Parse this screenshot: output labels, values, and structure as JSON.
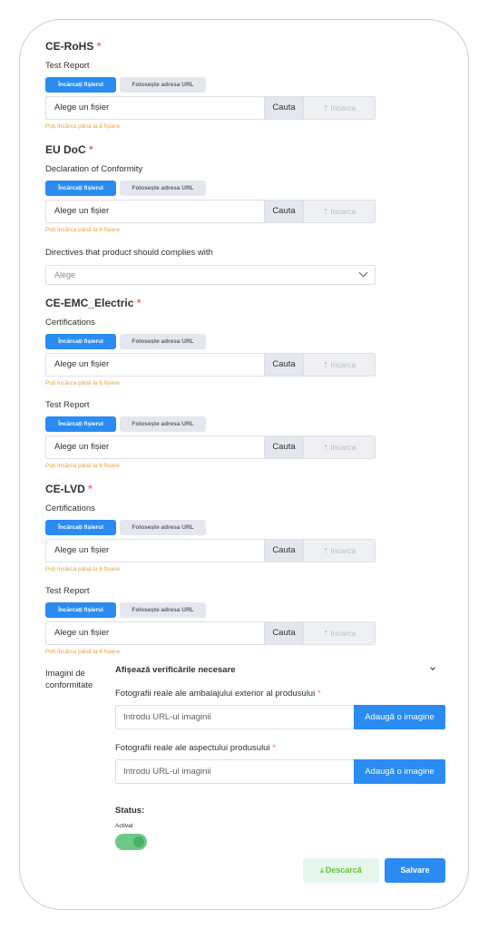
{
  "tabs": {
    "upload": "Încărcați fișierul",
    "url": "Folosește adresa URL"
  },
  "file_input": {
    "placeholder": "Alege un fișier",
    "browse": "Cauta",
    "upload": "Incarca"
  },
  "hint": "Poți încărca până la 6 fișiere",
  "rohs": {
    "title": "CE-RoHS",
    "req": "*",
    "label": "Test Report"
  },
  "eudoc": {
    "title": "EU DoC",
    "req": "*",
    "label": "Declaration of Conformity"
  },
  "directives": {
    "label": "Directives that product should complies with",
    "select_value": "Alege"
  },
  "emc": {
    "title": "CE-EMC_Electric",
    "req": "*",
    "label1": "Certifications",
    "label2": "Test Report"
  },
  "lvd": {
    "title": "CE-LVD",
    "req": "*",
    "label1": "Certifications",
    "label2": "Test Report"
  },
  "conformity": {
    "label": "Imagini de conformitate",
    "show_checks": "Afișează verificările necesare",
    "photo1_label": "Fotografii reale ale ambalajului exterior al produsului",
    "photo2_label": "Fotografii reale ale aspectului produsului",
    "req": "*",
    "url_placeholder": "Introdu URL-ul imaginii",
    "add_image": "Adaugă o imagine"
  },
  "status": {
    "label": "Status:",
    "state": "Activat",
    "enabled": true
  },
  "actions": {
    "download": "Descarcă",
    "save": "Salvare"
  },
  "colors": {
    "primary": "#2a8bf2",
    "required": "#f56c6c",
    "hint": "#e6a23c",
    "success": "#67c23a"
  }
}
